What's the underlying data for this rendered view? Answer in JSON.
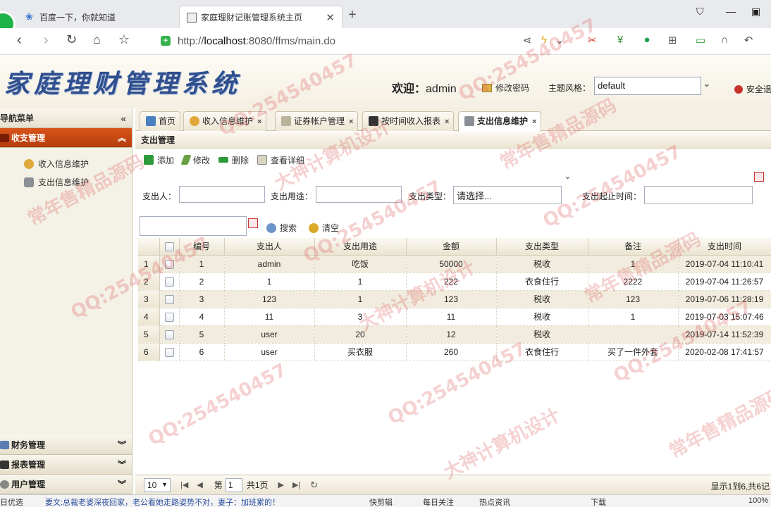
{
  "browser": {
    "tabs": [
      {
        "title": "百度一下，你就知道"
      },
      {
        "title": "家庭理财记账管理系统主页"
      }
    ],
    "new_tab": "+",
    "url_prefix": "http://",
    "url_host": "localhost",
    "url_rest": ":8080/ffms/main.do"
  },
  "app": {
    "logo_text": "家庭理财管理系统",
    "welcome_label": "欢迎：",
    "username": "admin",
    "change_password": "修改密码",
    "theme_label": "主题风格：",
    "theme_value": "default",
    "logout": "安全退"
  },
  "sidebar": {
    "header": "导航菜单",
    "active_section": "收支管理",
    "items": [
      {
        "label": "收入信息维护"
      },
      {
        "label": "支出信息维护"
      }
    ],
    "bottom_sections": [
      {
        "label": "财务管理"
      },
      {
        "label": "报表管理"
      },
      {
        "label": "用户管理"
      }
    ]
  },
  "tabs": [
    {
      "label": "首页"
    },
    {
      "label": "收入信息维护"
    },
    {
      "label": "证券帐户管理"
    },
    {
      "label": "按时间收入报表"
    },
    {
      "label": "支出信息维护"
    }
  ],
  "panel": {
    "title": "支出管理",
    "toolbar": {
      "add": "添加",
      "edit": "修改",
      "delete": "删除",
      "view": "查看详细"
    },
    "search": {
      "payer_label": "支出人：",
      "purpose_label": "支出用途：",
      "type_label": "支出类型：",
      "type_placeholder": "请选择...",
      "period_label": "支出起止时间：",
      "search_button": "搜索",
      "clear_button": "清空"
    }
  },
  "table": {
    "columns": [
      "编号",
      "支出人",
      "支出用途",
      "金额",
      "支出类型",
      "备注",
      "支出时间"
    ],
    "rows": [
      {
        "n": "1",
        "id": "1",
        "payer": "admin",
        "purpose": "吃饭",
        "amount": "50000",
        "type": "税收",
        "note": "1",
        "time": "2019-07-04 11:10:41"
      },
      {
        "n": "2",
        "id": "2",
        "payer": "1",
        "purpose": "1",
        "amount": "222",
        "type": "衣食住行",
        "note": "2222",
        "time": "2019-07-04 11:26:57"
      },
      {
        "n": "3",
        "id": "3",
        "payer": "123",
        "purpose": "1",
        "amount": "123",
        "type": "税收",
        "note": "123",
        "time": "2019-07-06 11:28:19"
      },
      {
        "n": "4",
        "id": "4",
        "payer": "11",
        "purpose": "3",
        "amount": "11",
        "type": "税收",
        "note": "1",
        "time": "2019-07-03 15:07:46"
      },
      {
        "n": "5",
        "id": "5",
        "payer": "user",
        "purpose": "20",
        "amount": "12",
        "type": "税收",
        "note": "",
        "time": "2019-07-14 11:52:39"
      },
      {
        "n": "6",
        "id": "6",
        "payer": "user",
        "purpose": "买衣服",
        "amount": "260",
        "type": "衣食住行",
        "note": "买了一件外套",
        "time": "2020-02-08 17:41:57"
      }
    ]
  },
  "pager": {
    "page_size": "10",
    "page_prefix": "第",
    "page_value": "1",
    "page_total": "共1页",
    "info": "显示1到6,共6记"
  },
  "statusbar": {
    "left": "日优选",
    "news": "要文:总裁老婆深夜回家，老公看她走路姿势不对，妻子：加班累的！",
    "tools": [
      "快剪辑",
      "每日关注",
      "热点资讯",
      "下载",
      "100%"
    ]
  },
  "watermark": {
    "qq": "QQ:254540457",
    "shop": "常年售精品源码",
    "design": "大神计算机设计"
  }
}
